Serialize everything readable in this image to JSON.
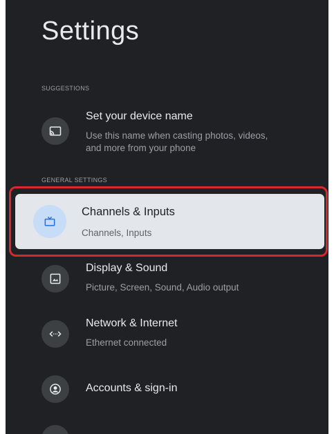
{
  "page_title": "Settings",
  "sections": {
    "suggestions_header": "SUGGESTIONS",
    "general_header": "GENERAL SETTINGS"
  },
  "suggestion": {
    "title": "Set your device name",
    "subtitle_line1": "Use this name when casting photos, videos,",
    "subtitle_line2": "and more from your phone",
    "icon": "cast-icon"
  },
  "items": [
    {
      "title": "Channels & Inputs",
      "subtitle": "Channels, Inputs",
      "icon": "tv-icon",
      "focused": true
    },
    {
      "title": "Display & Sound",
      "subtitle": "Picture, Screen, Sound, Audio output",
      "icon": "image-icon"
    },
    {
      "title": "Network & Internet",
      "subtitle": "Ethernet connected",
      "icon": "network-icon"
    },
    {
      "title": "Accounts & sign-in",
      "subtitle": "",
      "icon": "account-icon"
    }
  ],
  "colors": {
    "background": "#202124",
    "focus_card": "#e3e6ea",
    "focus_outline": "#d9272e",
    "focus_icon_bg": "#c7dcf7",
    "icon_bg": "#3c4043",
    "text_primary": "#e8eaed",
    "text_secondary": "#9aa0a6"
  }
}
